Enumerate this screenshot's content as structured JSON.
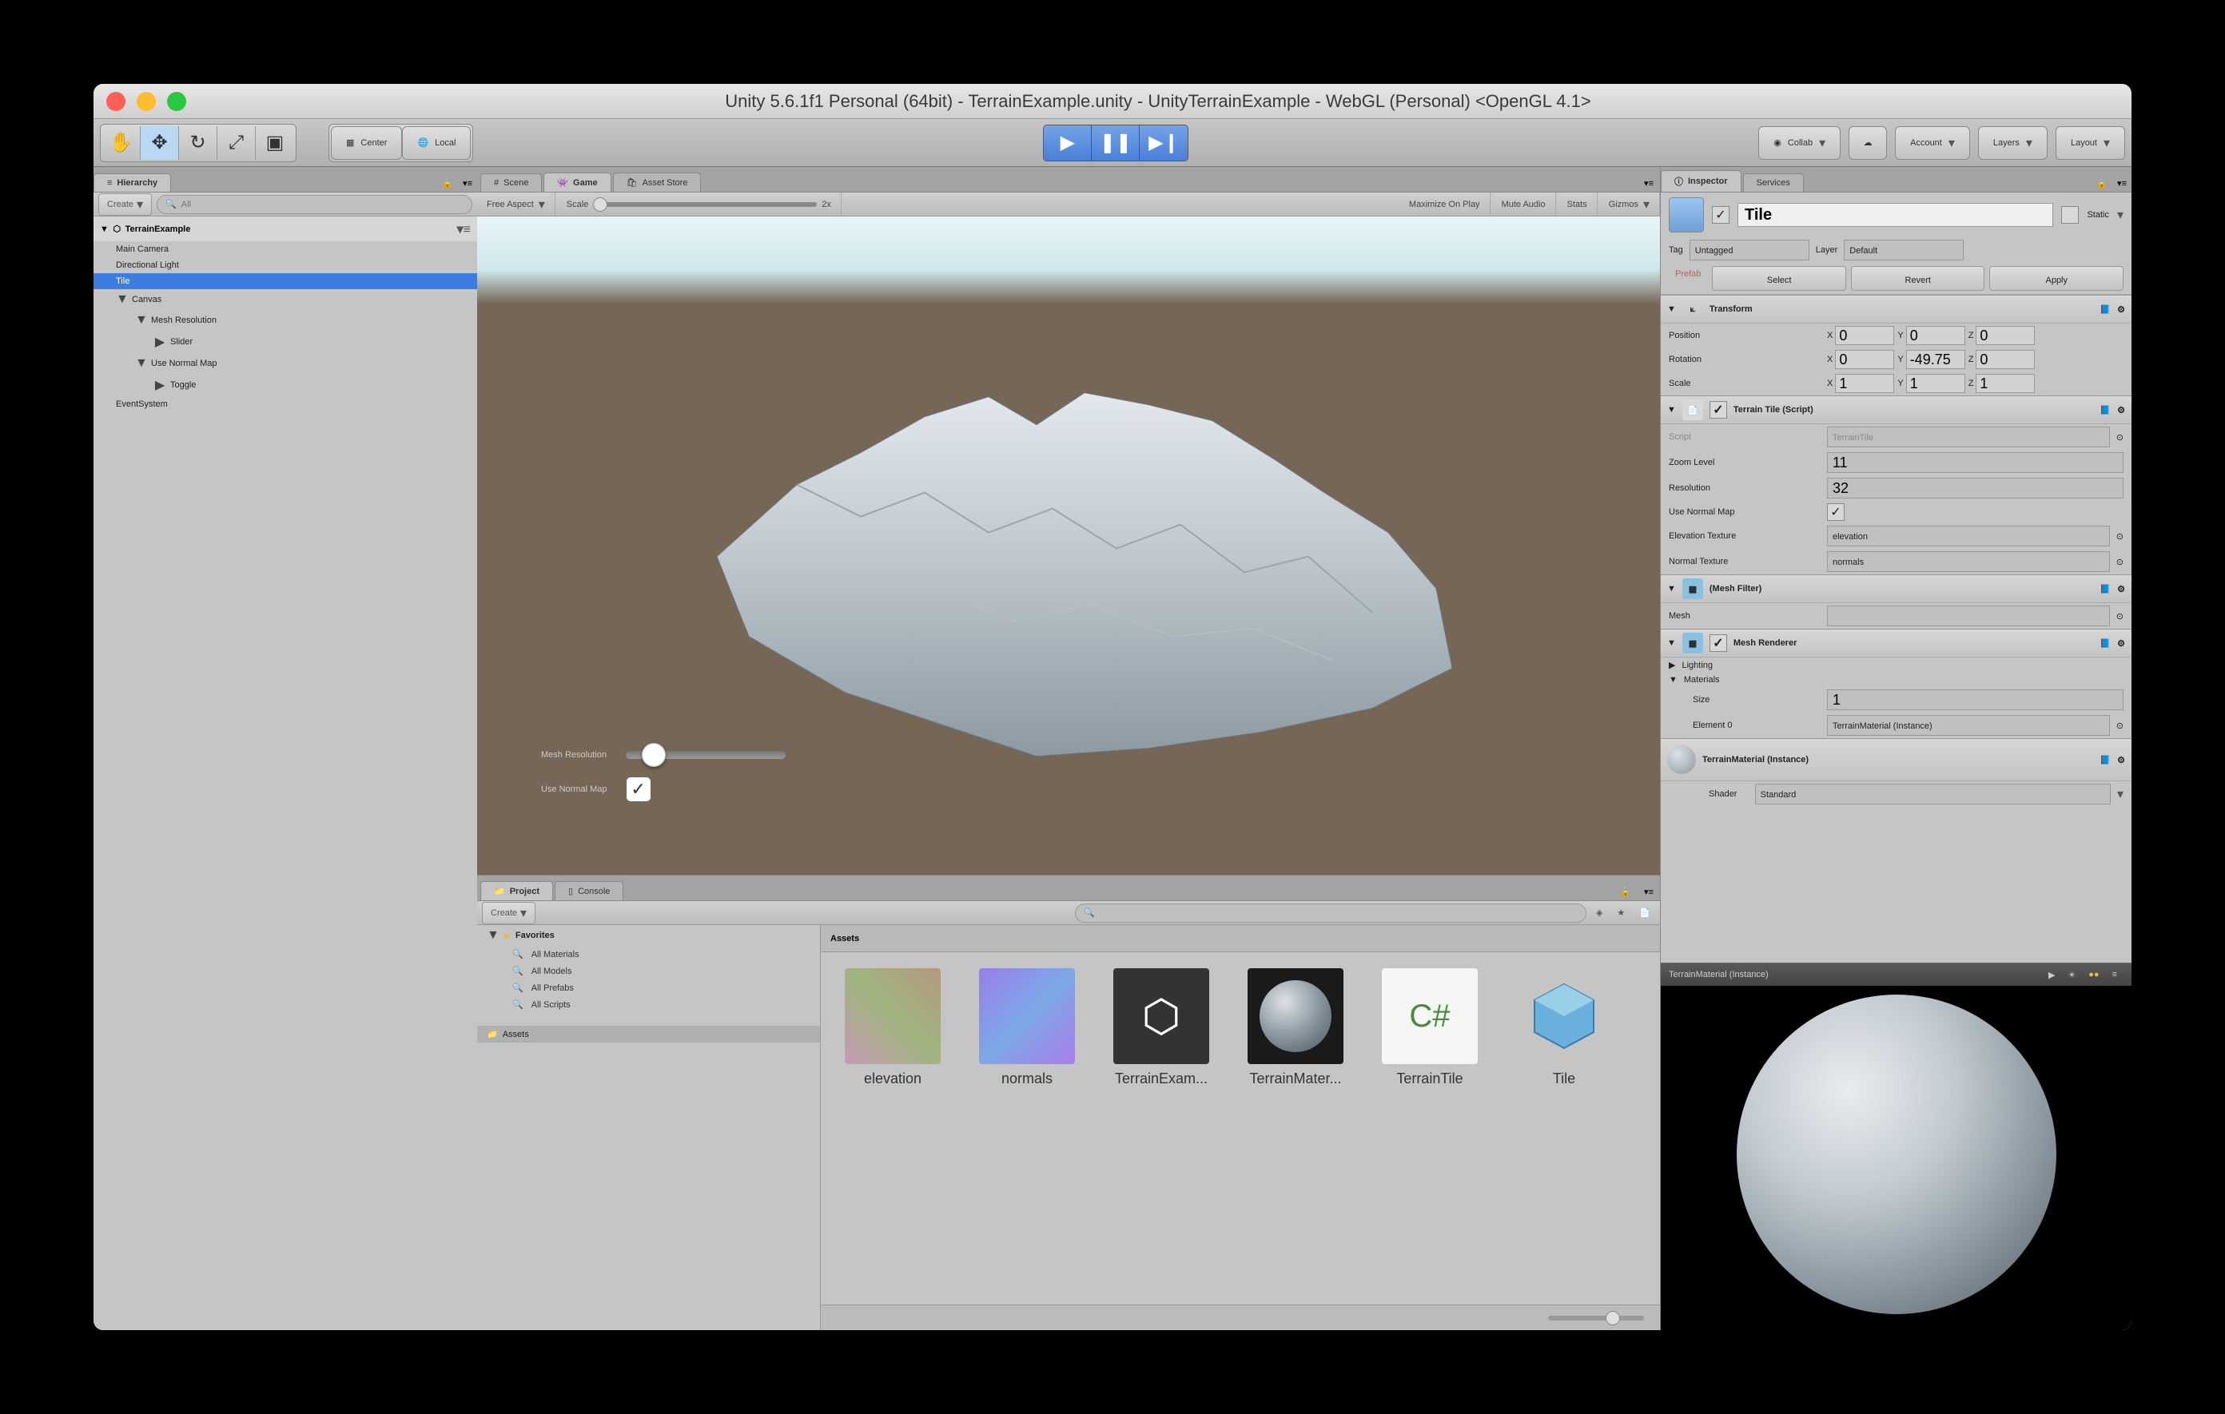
{
  "titlebar": "Unity 5.6.1f1 Personal (64bit) - TerrainExample.unity - UnityTerrainExample - WebGL (Personal) <OpenGL 4.1>",
  "toolbar": {
    "center": "Center",
    "local": "Local",
    "collab": "Collab",
    "account": "Account",
    "layers": "Layers",
    "layout": "Layout"
  },
  "hierarchy": {
    "tab": "Hierarchy",
    "create": "Create",
    "search_placeholder": "All",
    "scene": "TerrainExample",
    "items": [
      "Main Camera",
      "Directional Light",
      "Tile",
      "Canvas",
      "Mesh Resolution",
      "Slider",
      "Use Normal Map",
      "Toggle",
      "EventSystem"
    ]
  },
  "centerTabs": {
    "scene": "Scene",
    "game": "Game",
    "asset_store": "Asset Store"
  },
  "gamebar": {
    "aspect": "Free Aspect",
    "scale_label": "Scale",
    "scale_val": "2x",
    "maximize": "Maximize On Play",
    "mute": "Mute Audio",
    "stats": "Stats",
    "gizmos": "Gizmos"
  },
  "overlay": {
    "mesh_res": "Mesh Resolution",
    "use_normal": "Use Normal Map"
  },
  "project": {
    "tab": "Project",
    "console_tab": "Console",
    "create": "Create",
    "favorites": "Favorites",
    "fav_items": [
      "All Materials",
      "All Models",
      "All Prefabs",
      "All Scripts"
    ],
    "assets_folder": "Assets",
    "assets_head": "Assets",
    "assets": [
      "elevation",
      "normals",
      "TerrainExam...",
      "TerrainMater...",
      "TerrainTile",
      "Tile"
    ]
  },
  "inspector": {
    "tab": "Inspector",
    "services_tab": "Services",
    "obj_name": "Tile",
    "static": "Static",
    "tag_label": "Tag",
    "tag_val": "Untagged",
    "layer_label": "Layer",
    "layer_val": "Default",
    "prefab": {
      "label": "Prefab",
      "select": "Select",
      "revert": "Revert",
      "apply": "Apply"
    },
    "transform": {
      "title": "Transform",
      "position": "Position",
      "pos": {
        "x": "0",
        "y": "0",
        "z": "0"
      },
      "rotation": "Rotation",
      "rot": {
        "x": "0",
        "y": "-49.75",
        "z": "0"
      },
      "scale": "Scale",
      "scl": {
        "x": "1",
        "y": "1",
        "z": "1"
      }
    },
    "terrain_tile": {
      "title": "Terrain Tile (Script)",
      "script_label": "Script",
      "script_val": "TerrainTile",
      "zoom_label": "Zoom Level",
      "zoom_val": "11",
      "res_label": "Resolution",
      "res_val": "32",
      "normal_label": "Use Normal Map",
      "elev_label": "Elevation Texture",
      "elev_val": "elevation",
      "norm_tex_label": "Normal Texture",
      "norm_tex_val": "normals"
    },
    "mesh_filter": {
      "title": "(Mesh Filter)",
      "mesh_label": "Mesh"
    },
    "mesh_renderer": {
      "title": "Mesh Renderer",
      "lighting": "Lighting",
      "materials": "Materials",
      "size_label": "Size",
      "size_val": "1",
      "elem_label": "Element 0",
      "elem_val": "TerrainMaterial (Instance)"
    },
    "material": {
      "title": "TerrainMaterial (Instance)",
      "shader_label": "Shader",
      "shader_val": "Standard"
    },
    "preview_title": "TerrainMaterial (Instance)"
  }
}
